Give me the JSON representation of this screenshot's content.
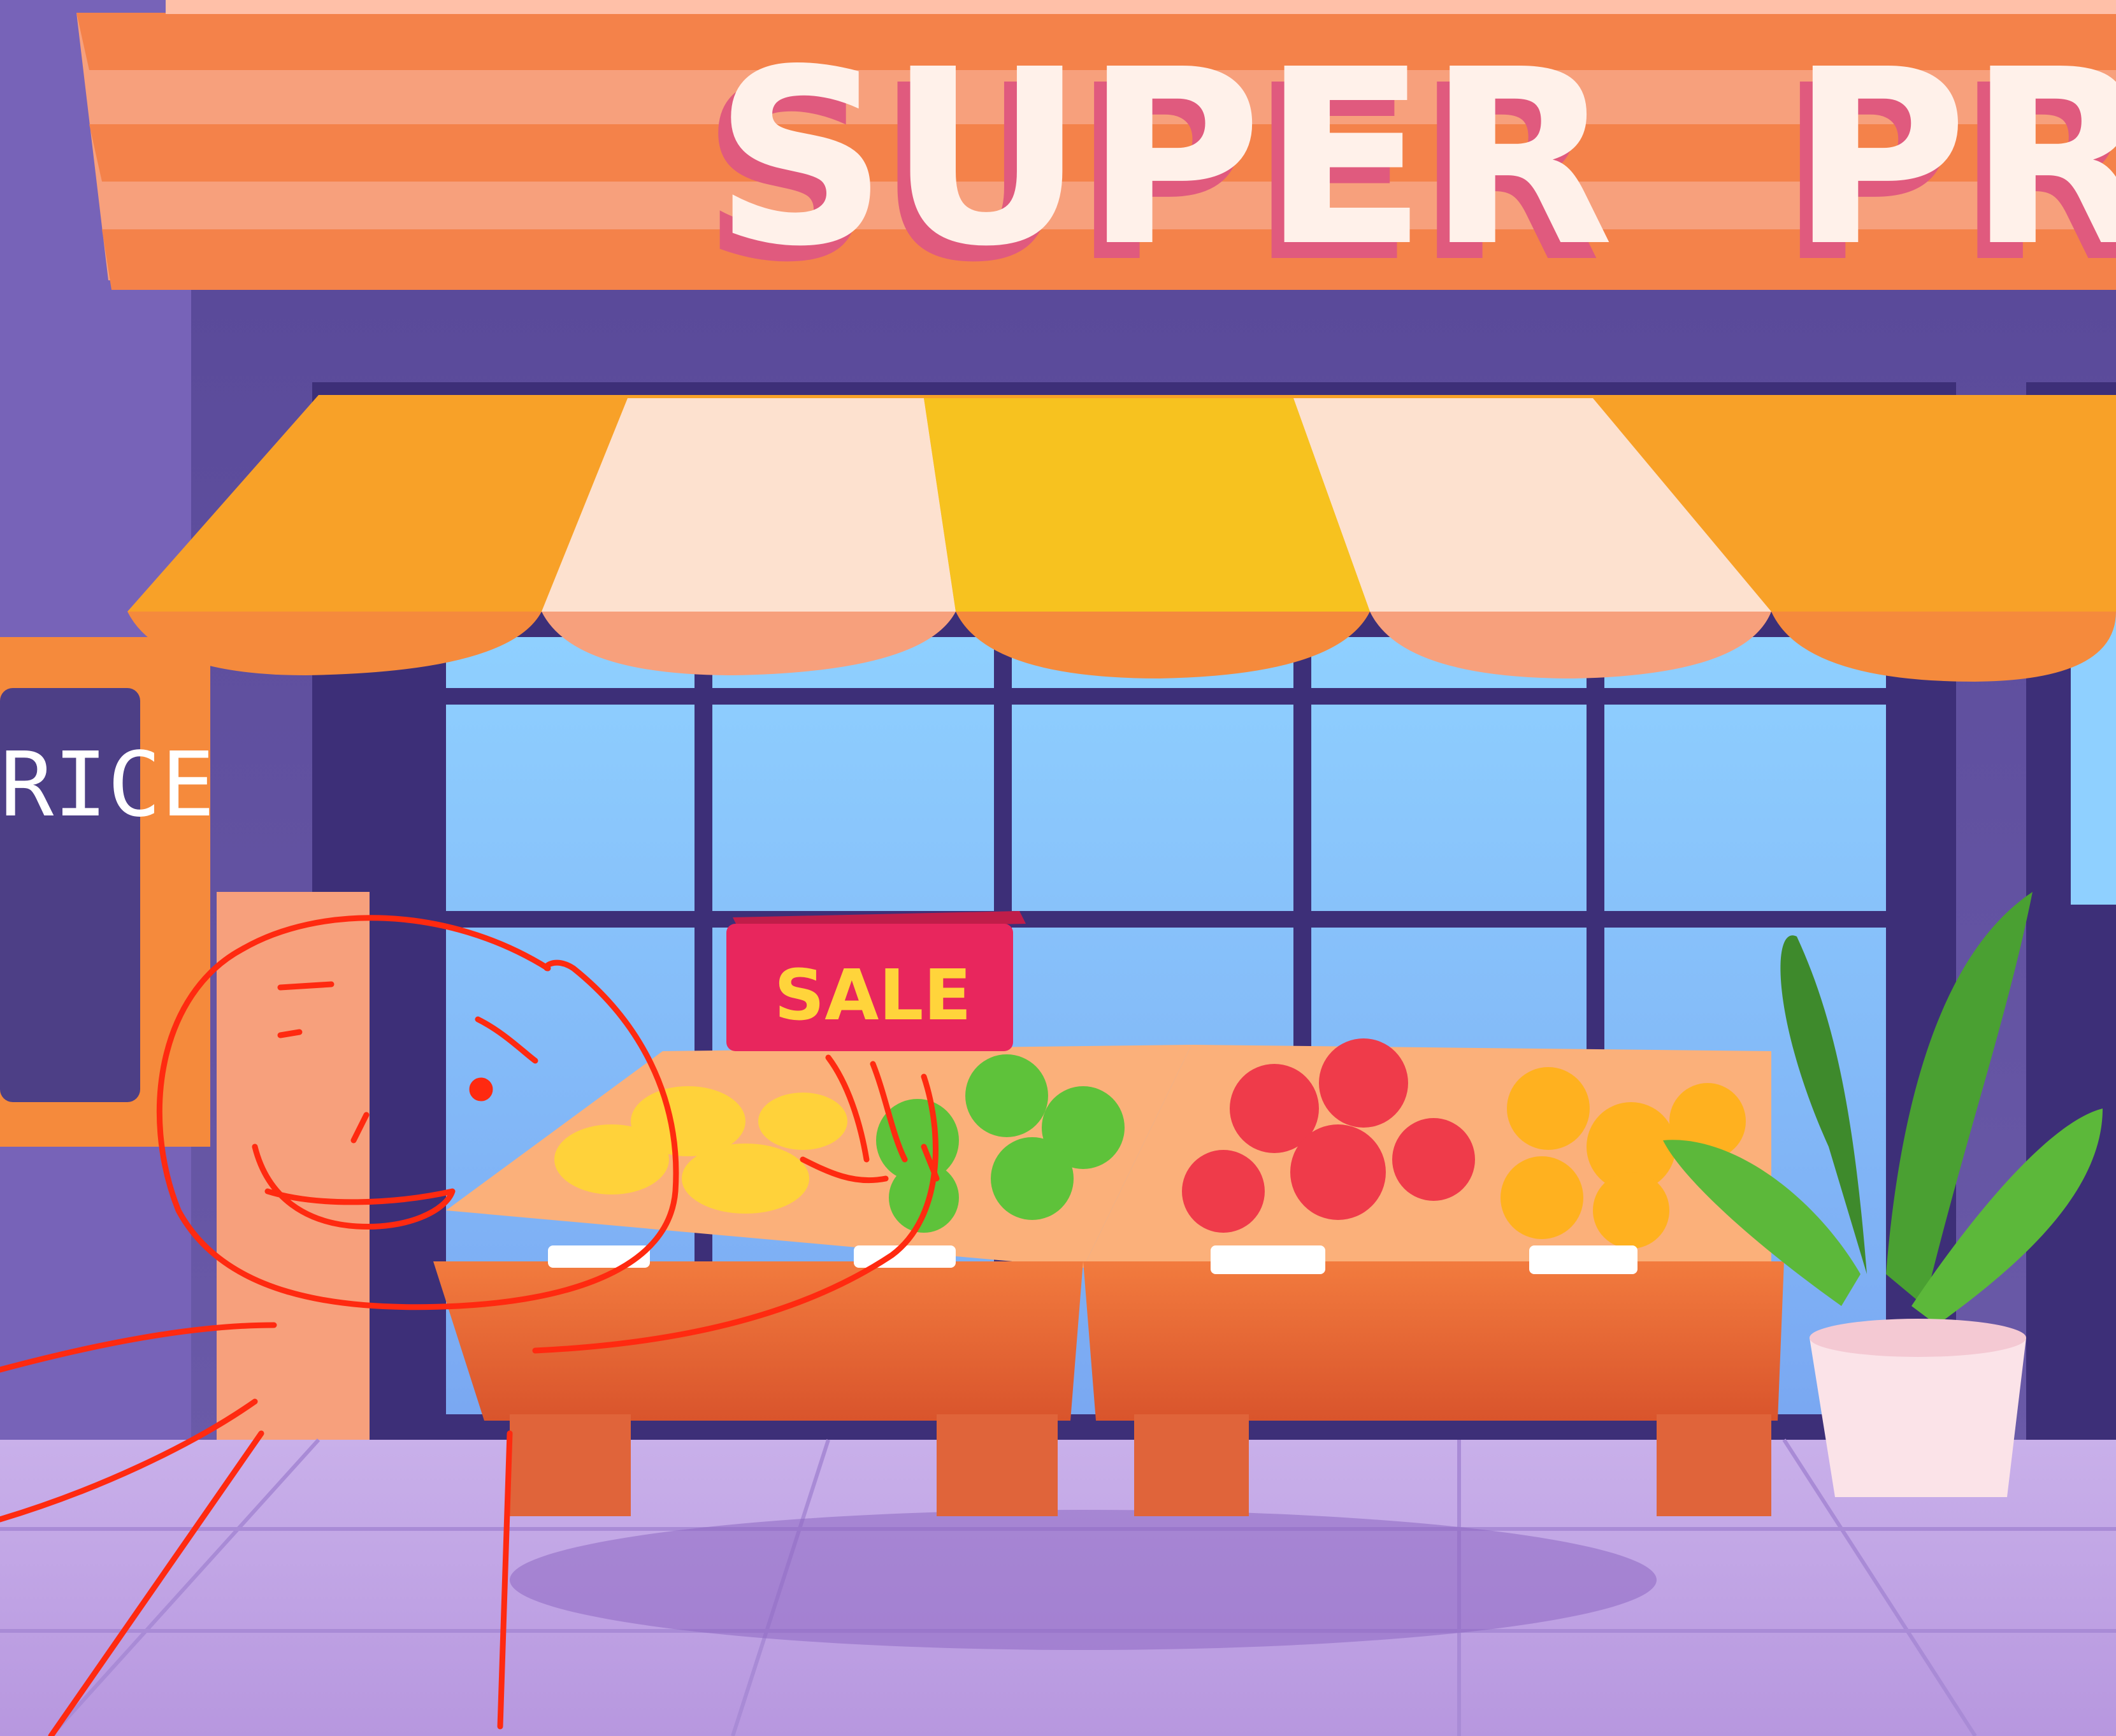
{
  "store_sign": {
    "word1": "SUPER",
    "word2": "PR",
    "face_color": "#fff1ea",
    "shadow_color": "#e05a7e",
    "band_color": "#f4824a"
  },
  "price_board": {
    "text": "RICE"
  },
  "sale_sign": {
    "text": "SALE",
    "color": "#e8265d",
    "text_color": "#ffd43b"
  },
  "awning": {
    "stripe_colors": [
      "#f8a128",
      "#fde1cf"
    ],
    "trim_color": "#f58a3c"
  },
  "stalls": {
    "produce": [
      "banana",
      "green-apple",
      "red-apple",
      "orange"
    ]
  },
  "doodle": {
    "stroke_color": "#ff2a10"
  },
  "icons": {
    "plant": "potted-plant-icon"
  }
}
